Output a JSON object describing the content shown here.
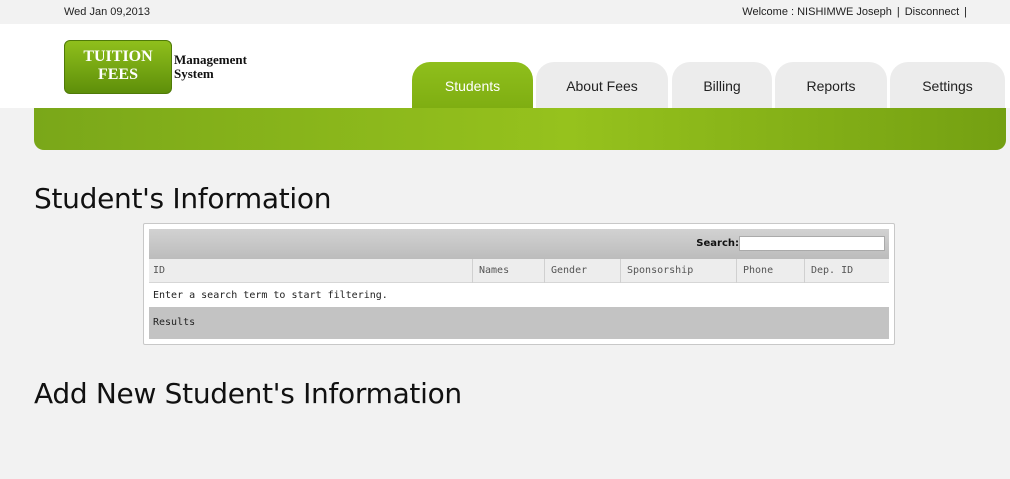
{
  "topbar": {
    "date": "Wed Jan 09,2013",
    "welcome": "Welcome : NISHIMWE Joseph",
    "separator": "|",
    "disconnect": "Disconnect"
  },
  "logo": {
    "line1": "TUITION",
    "line2": "FEES",
    "sub1": "Management",
    "sub2": "System"
  },
  "nav": {
    "tabs": [
      {
        "label": "Students"
      },
      {
        "label": "About Fees"
      },
      {
        "label": "Billing"
      },
      {
        "label": "Reports"
      },
      {
        "label": "Settings"
      }
    ],
    "active": "Students"
  },
  "student_info": {
    "title": "Student's Information",
    "search_label": "Search:",
    "search_value": "",
    "columns": [
      "ID",
      "Names",
      "Gender",
      "Sponsorship",
      "Phone",
      "Dep. ID"
    ],
    "empty_message": "Enter a search term to start filtering.",
    "footer": "Results"
  },
  "add_student": {
    "title": "Add New Student's Information"
  },
  "colors": {
    "accent": "#8fbf1c",
    "accent_dark": "#5e8f0a"
  }
}
